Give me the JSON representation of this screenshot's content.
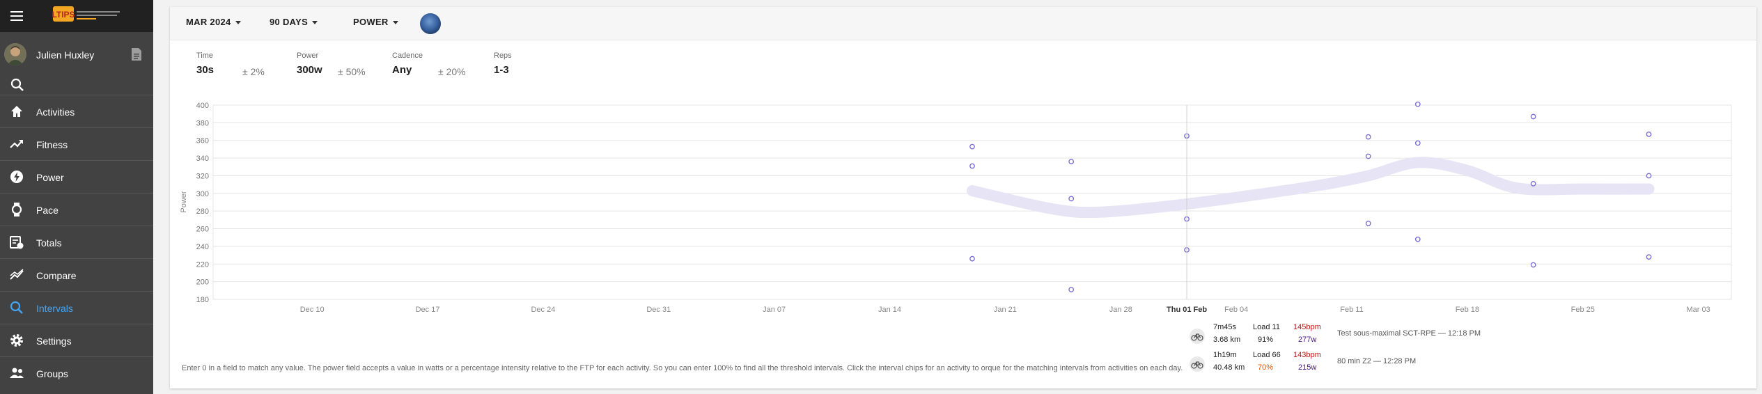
{
  "sidebar": {
    "logo_text": "LTIPS",
    "user_name": "Julien Huxley",
    "items": [
      {
        "label": "Activities",
        "icon": "home-icon",
        "active": false
      },
      {
        "label": "Fitness",
        "icon": "trending-up-icon",
        "active": false
      },
      {
        "label": "Power",
        "icon": "power-icon",
        "active": false
      },
      {
        "label": "Pace",
        "icon": "watch-icon",
        "active": false
      },
      {
        "label": "Totals",
        "icon": "totals-icon",
        "active": false
      },
      {
        "label": "Compare",
        "icon": "compare-icon",
        "active": false
      },
      {
        "label": "Intervals",
        "icon": "search-icon",
        "active": true
      },
      {
        "label": "Settings",
        "icon": "gear-icon",
        "active": false
      },
      {
        "label": "Groups",
        "icon": "groups-icon",
        "active": false
      }
    ]
  },
  "toolbar": {
    "month_label": "MAR 2024",
    "range_label": "90 DAYS",
    "metric_label": "POWER"
  },
  "filters": {
    "time": {
      "label": "Time",
      "value": "30s",
      "tolerance": "± 2%"
    },
    "power": {
      "label": "Power",
      "value": "300w",
      "tolerance": "± 50%"
    },
    "cadence": {
      "label": "Cadence",
      "value": "Any",
      "tolerance": "± 20%"
    },
    "reps": {
      "label": "Reps",
      "value": "1-3"
    }
  },
  "chart_data": {
    "type": "scatter",
    "ylabel": "Power",
    "ylim": [
      180,
      400
    ],
    "y_ticks": [
      180,
      200,
      220,
      240,
      260,
      280,
      300,
      320,
      340,
      360,
      380,
      400
    ],
    "x_range": [
      "2023-12-04",
      "2024-03-05"
    ],
    "x_ticks": [
      {
        "date": "2023-12-10",
        "label": "Dec 10"
      },
      {
        "date": "2023-12-17",
        "label": "Dec 17"
      },
      {
        "date": "2023-12-24",
        "label": "Dec 24"
      },
      {
        "date": "2023-12-31",
        "label": "Dec 31"
      },
      {
        "date": "2024-01-07",
        "label": "Jan 07"
      },
      {
        "date": "2024-01-14",
        "label": "Jan 14"
      },
      {
        "date": "2024-01-21",
        "label": "Jan 21"
      },
      {
        "date": "2024-01-28",
        "label": "Jan 28"
      },
      {
        "date": "2024-02-01",
        "label": "Thu 01 Feb",
        "highlight": true
      },
      {
        "date": "2024-02-04",
        "label": "Feb 04"
      },
      {
        "date": "2024-02-11",
        "label": "Feb 11"
      },
      {
        "date": "2024-02-18",
        "label": "Feb 18"
      },
      {
        "date": "2024-02-25",
        "label": "Feb 25"
      },
      {
        "date": "2024-03-03",
        "label": "Mar 03"
      }
    ],
    "crosshair_date": "2024-02-01",
    "points": [
      {
        "x": "2024-01-19",
        "y": 353
      },
      {
        "x": "2024-01-19",
        "y": 331
      },
      {
        "x": "2024-01-19",
        "y": 226
      },
      {
        "x": "2024-01-25",
        "y": 336
      },
      {
        "x": "2024-01-25",
        "y": 294
      },
      {
        "x": "2024-01-25",
        "y": 191
      },
      {
        "x": "2024-02-01",
        "y": 365
      },
      {
        "x": "2024-02-01",
        "y": 271
      },
      {
        "x": "2024-02-01",
        "y": 236
      },
      {
        "x": "2024-02-12",
        "y": 364
      },
      {
        "x": "2024-02-12",
        "y": 342
      },
      {
        "x": "2024-02-12",
        "y": 266
      },
      {
        "x": "2024-02-15",
        "y": 401
      },
      {
        "x": "2024-02-15",
        "y": 357
      },
      {
        "x": "2024-02-15",
        "y": 248
      },
      {
        "x": "2024-02-22",
        "y": 387
      },
      {
        "x": "2024-02-22",
        "y": 311
      },
      {
        "x": "2024-02-22",
        "y": 219
      },
      {
        "x": "2024-02-29",
        "y": 367
      },
      {
        "x": "2024-02-29",
        "y": 320
      },
      {
        "x": "2024-02-29",
        "y": 228
      }
    ],
    "trend": [
      {
        "x": "2024-01-19",
        "y": 303
      },
      {
        "x": "2024-01-24",
        "y": 282
      },
      {
        "x": "2024-01-27",
        "y": 279
      },
      {
        "x": "2024-02-01",
        "y": 288
      },
      {
        "x": "2024-02-05",
        "y": 298
      },
      {
        "x": "2024-02-09",
        "y": 309
      },
      {
        "x": "2024-02-12",
        "y": 320
      },
      {
        "x": "2024-02-15",
        "y": 335
      },
      {
        "x": "2024-02-18",
        "y": 326
      },
      {
        "x": "2024-02-21",
        "y": 306
      },
      {
        "x": "2024-02-25",
        "y": 305
      },
      {
        "x": "2024-02-29",
        "y": 305
      }
    ],
    "colors": {
      "point": "#7b6fd6",
      "trend": "#e6e4f5",
      "grid": "#e5e5e5",
      "crosshair": "#d0d0d0"
    }
  },
  "tooltip": {
    "rows": [
      {
        "duration": "7m45s",
        "distance": "3.68 km",
        "load_label": "Load 11",
        "intensity": "91%",
        "intensity_color": "#212121",
        "heart_rate": "145bpm",
        "watts": "277w",
        "description": "Test sous-maximal SCT-RPE — 12:18 PM"
      },
      {
        "duration": "1h19m",
        "distance": "40.48 km",
        "load_label": "Load 66",
        "intensity": "70%",
        "intensity_color": "#e65100",
        "heart_rate": "143bpm",
        "watts": "215w",
        "description": "80 min Z2 — 12:28 PM"
      }
    ]
  },
  "footnote": "Enter 0 in a field to match any value. The power field accepts a value in watts or a percentage intensity relative to the FTP for each activity. So you can enter 100% to find all the threshold intervals. Click the interval chips for an activity to                                                                                                                   orque for the matching intervals from activities on each day."
}
